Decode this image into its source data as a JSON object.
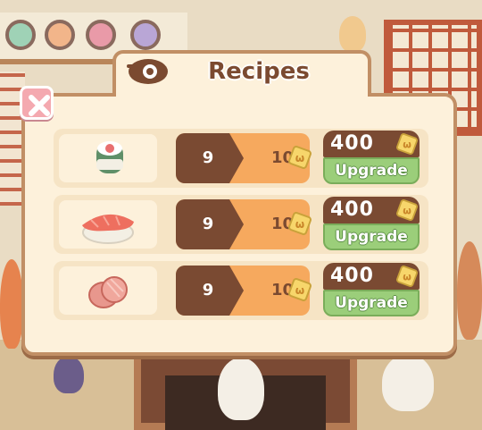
{
  "dialog": {
    "title": "Recipes",
    "title_icon": "bowl-icon",
    "close_icon": "close-icon"
  },
  "recipes": [
    {
      "dish_icon": "maki-roll-icon",
      "level_current": "9",
      "level_next": "10",
      "level_icon": "coin-icon",
      "upgrade_cost": "400",
      "cost_icon": "coin-icon",
      "upgrade_label": "Upgrade"
    },
    {
      "dish_icon": "tuna-nigiri-icon",
      "level_current": "9",
      "level_next": "10",
      "level_icon": "coin-icon",
      "upgrade_cost": "400",
      "cost_icon": "coin-icon",
      "upgrade_label": "Upgrade"
    },
    {
      "dish_icon": "salmon-slices-icon",
      "level_current": "9",
      "level_next": "10",
      "level_icon": "coin-icon",
      "upgrade_cost": "400",
      "cost_icon": "coin-icon",
      "upgrade_label": "Upgrade"
    }
  ],
  "colors": {
    "panel": "#fdf1db",
    "panel_border": "#c18f65",
    "level_dark": "#7a4a32",
    "level_light": "#f6a95e",
    "upgrade_green": "#9bce7a",
    "close_pink": "#f4a9b0",
    "coin_yellow": "#f7d66b"
  }
}
